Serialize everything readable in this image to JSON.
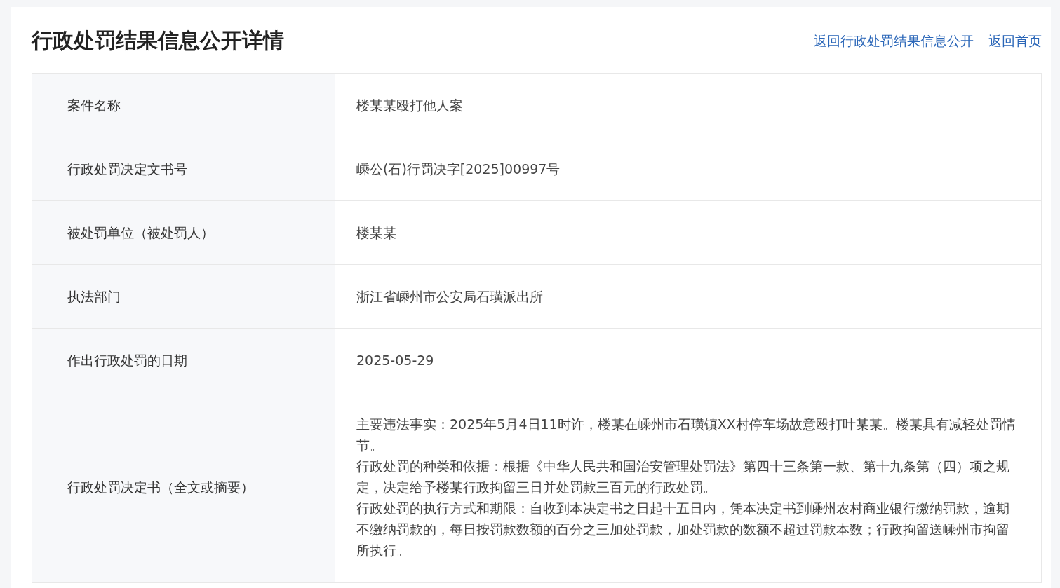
{
  "title": "行政处罚结果信息公开详情",
  "links": [
    "返回行政处罚结果信息公开",
    "返回首页"
  ],
  "rows": [
    {
      "label": "案件名称",
      "value": [
        "楼某某殴打他人案"
      ]
    },
    {
      "label": "行政处罚决定文书号",
      "value": [
        "嵊公(石)行罚决字[2025]00997号"
      ]
    },
    {
      "label": "被处罚单位（被处罚人）",
      "value": [
        "楼某某"
      ]
    },
    {
      "label": "执法部门",
      "value": [
        "浙江省嵊州市公安局石璜派出所"
      ]
    },
    {
      "label": "作出行政处罚的日期",
      "value": [
        "2025-05-29"
      ]
    },
    {
      "label": "行政处罚决定书（全文或摘要）",
      "value": [
        "主要违法事实：2025年5月4日11时许，楼某在嵊州市石璜镇XX村停车场故意殴打叶某某。楼某具有减轻处罚情节。",
        "行政处罚的种类和依据：根据《中华人民共和国治安管理处罚法》第四十三条第一款、第十九条第（四）项之规定，决定给予楼某行政拘留三日并处罚款三百元的行政处罚。",
        "行政处罚的执行方式和期限：自收到本决定书之日起十五日内，凭本决定书到嵊州农村商业银行缴纳罚款，逾期不缴纳罚款的，每日按罚款数额的百分之三加处罚款，加处罚款的数额不超过罚款本数；行政拘留送嵊州市拘留所执行。"
      ]
    }
  ]
}
